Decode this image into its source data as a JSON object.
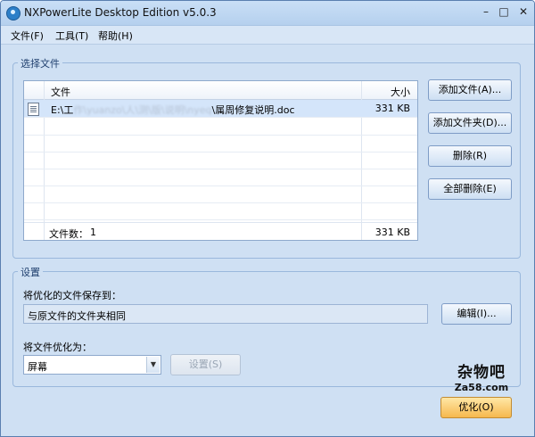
{
  "window": {
    "title": "NXPowerLite Desktop Edition v5.0.3"
  },
  "window_controls": {
    "minimize": "–",
    "maximize": "□",
    "close": "✕"
  },
  "menu": [
    "文件(F)",
    "工具(T)",
    "帮助(H)"
  ],
  "file_group": {
    "legend": "选择文件",
    "columns": {
      "name": "文件",
      "size": "大小"
    },
    "files": [
      {
        "name_prefix": "E:\\工",
        "name_blurred": "作\\yuanzo\\人\\测\\版\\说明\\nyeq",
        "name_suffix": "\\属周修复说明.doc",
        "size": "331 KB",
        "icon": "doc-file-icon"
      }
    ],
    "footer": {
      "count_label": "文件数：",
      "count": "1",
      "total_size": "331 KB"
    },
    "buttons": {
      "add_files": "添加文件(A)...",
      "add_folder": "添加文件夹(D)...",
      "remove": "删除(R)",
      "remove_all": "全部删除(E)"
    }
  },
  "settings_group": {
    "legend": "设置",
    "save_to_label": "将优化的文件保存到：",
    "save_to_value": "与原文件的文件夹相同",
    "edit_button": "编辑(I)...",
    "optimize_for_label": "将文件优化为：",
    "optimize_for_value": "屏幕",
    "settings_button": "设置(S)"
  },
  "watermark": {
    "line1": "杂物吧",
    "line2": "Za58.com"
  },
  "optimize_button": "优化(O)"
}
